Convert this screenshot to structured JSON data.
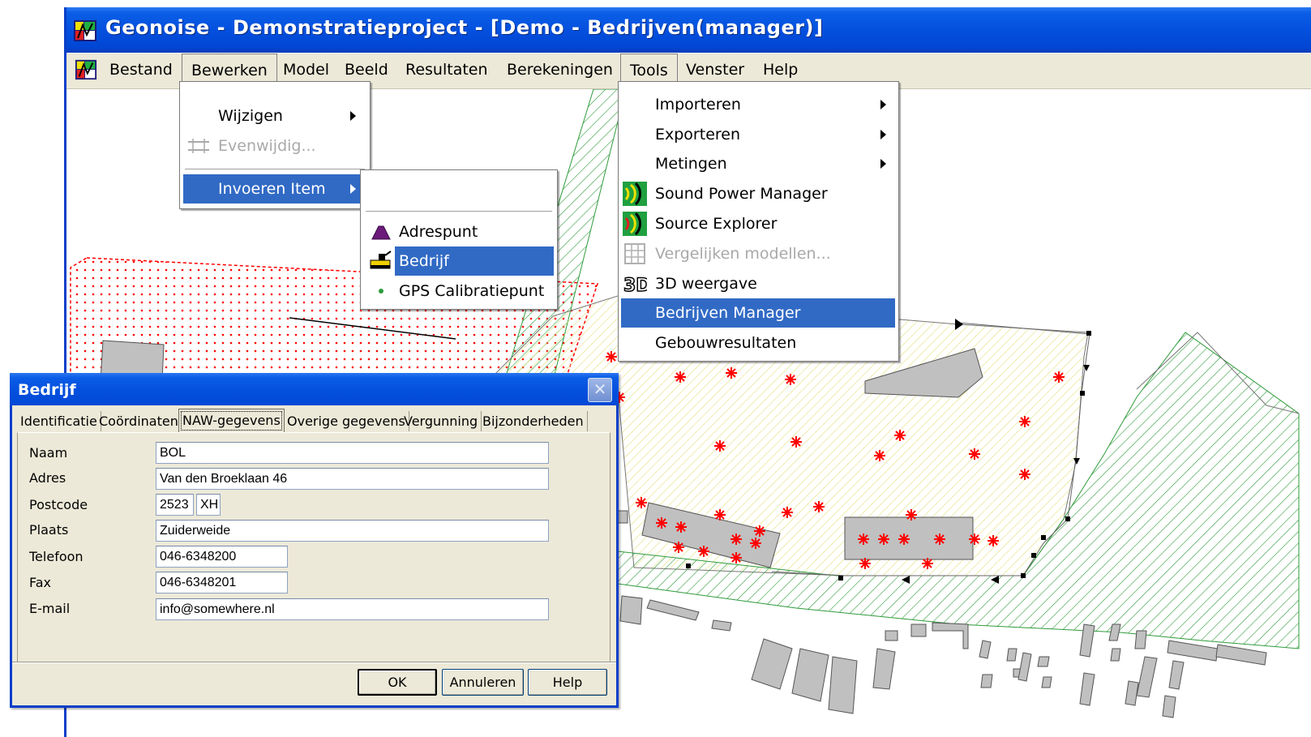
{
  "window": {
    "title": "Geonoise - Demonstratieproject - [Demo - Bedrijven(manager)]"
  },
  "menubar": {
    "items": [
      "Bestand",
      "Bewerken",
      "Model",
      "Beeld",
      "Resultaten",
      "Berekeningen",
      "Tools",
      "Venster",
      "Help"
    ]
  },
  "menus": {
    "bewerken": {
      "items": [
        {
          "label": "Wijzigen",
          "submenu": true,
          "state": "normal"
        },
        {
          "label": "Evenwijdig...",
          "submenu": false,
          "state": "disabled",
          "icon": "parallel-lines-icon"
        },
        {
          "label": "Invoeren Item",
          "submenu": true,
          "state": "selected"
        }
      ]
    },
    "invoeren_item": {
      "items": [
        {
          "label": "Adrespunt",
          "icon": "address-point-icon",
          "state": "normal"
        },
        {
          "label": "Bedrijf",
          "icon": "company-icon",
          "state": "selected"
        },
        {
          "label": "GPS Calibratiepunt",
          "icon": "gps-point-icon",
          "state": "normal"
        }
      ]
    },
    "tools": {
      "items": [
        {
          "label": "Importeren",
          "submenu": true,
          "state": "normal"
        },
        {
          "label": "Exporteren",
          "submenu": true,
          "state": "normal"
        },
        {
          "label": "Metingen",
          "submenu": true,
          "state": "normal"
        },
        {
          "label": "Sound Power Manager",
          "icon": "sound-power-icon",
          "state": "normal"
        },
        {
          "label": "Source Explorer",
          "icon": "source-explorer-icon",
          "state": "normal"
        },
        {
          "label": "Vergelijken modellen...",
          "icon": "compare-models-icon",
          "state": "disabled"
        },
        {
          "label": "3D weergave",
          "icon": "3d-view-icon",
          "state": "normal"
        },
        {
          "label": "Bedrijven Manager",
          "state": "selected"
        },
        {
          "label": "Gebouwresultaten",
          "state": "normal"
        }
      ]
    }
  },
  "dialog": {
    "title": "Bedrijf",
    "close_symbol": "✕",
    "tabs": [
      "Identificatie",
      "Coördinaten",
      "NAW-gegevens",
      "Overige gegevens",
      "Vergunning",
      "Bijzonderheden"
    ],
    "active_tab": "NAW-gegevens",
    "fields": {
      "naam": {
        "label": "Naam",
        "value": "BOL"
      },
      "adres": {
        "label": "Adres",
        "value": "Van den Broeklaan 46"
      },
      "postcode": {
        "label": "Postcode",
        "value_number": "2523",
        "value_letters": "XH"
      },
      "plaats": {
        "label": "Plaats",
        "value": "Zuiderweide"
      },
      "telefoon": {
        "label": "Telefoon",
        "value": "046-6348200"
      },
      "fax": {
        "label": "Fax",
        "value": "046-6348201"
      },
      "email": {
        "label": "E-mail",
        "value": "info@somewhere.nl"
      }
    },
    "buttons": {
      "ok": "OK",
      "cancel": "Annuleren",
      "help": "Help"
    }
  },
  "colors": {
    "titlebar": "#0450de",
    "menu_highlight": "#316ac5",
    "dialog_bg": "#ece9d8",
    "hatch_green": "#2e9b3a",
    "hatch_yellow": "#e3df7a",
    "dot_red": "#ff0000",
    "building_gray": "#c0c0c0"
  }
}
